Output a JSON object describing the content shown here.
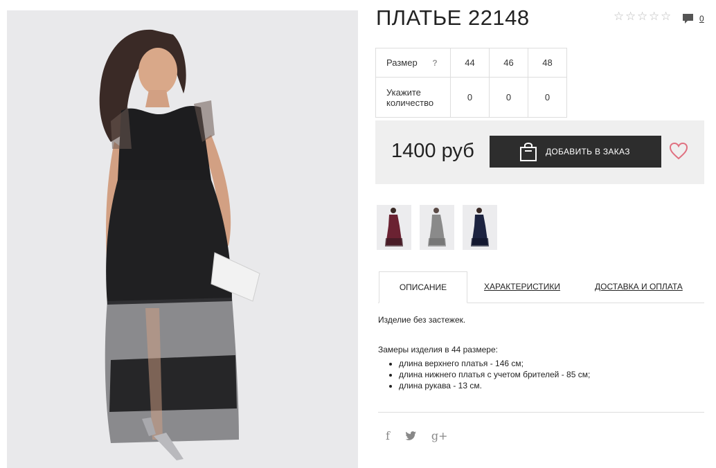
{
  "product": {
    "title": "ПЛАТЬЕ 22148",
    "rating_stars": 5,
    "comment_count": "0",
    "price": "1400 руб",
    "buy_label": "ДОБАВИТЬ В ЗАКАЗ"
  },
  "sizes": {
    "size_label": "Размер",
    "help": "?",
    "qty_label": "Укажите количество",
    "columns": [
      "44",
      "46",
      "48"
    ],
    "quantities": [
      "0",
      "0",
      "0"
    ]
  },
  "tabs": [
    {
      "label": "ОПИСАНИЕ"
    },
    {
      "label": "ХАРАКТЕРИСТИКИ"
    },
    {
      "label": "ДОСТАВКА И ОПЛАТА"
    }
  ],
  "description": {
    "line1": "Изделие без застежек.",
    "line2": "Замеры изделия в 44 размере:",
    "bullets": [
      "длина верхнего платья - 146 см;",
      "длина нижнего платья с учетом брителей - 85 см;",
      "длина рукава - 13 см."
    ]
  },
  "social": {
    "facebook": "f",
    "twitter": "twitter-icon",
    "googleplus": "g+"
  },
  "colors": {
    "button": "#2d2d2d",
    "heart": "#e07080",
    "thumb_colors": [
      "#6b2232",
      "#8a8a8a",
      "#1c2340"
    ]
  }
}
